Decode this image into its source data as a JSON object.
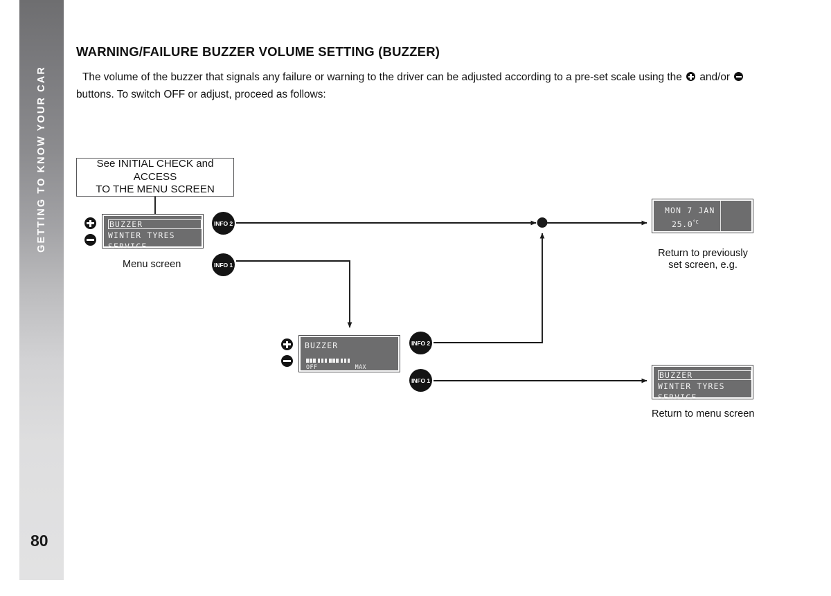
{
  "sidebar": {
    "chapter_label": "GETTING TO KNOW YOUR CAR",
    "page_number": "80"
  },
  "content": {
    "heading": "WARNING/FAILURE BUZZER VOLUME SETTING (BUZZER)",
    "paragraph_part_1": "The volume of the buzzer that signals any failure or warning to the driver can be adjusted according to a pre-set scale using the",
    "paragraph_part_2": "and/or",
    "paragraph_part_3": "buttons. To switch OFF or adjust, proceed as follows:"
  },
  "diagram": {
    "reference_box": {
      "line_1": "See INITIAL CHECK and ACCESS",
      "line_2": "TO THE MENU SCREEN"
    },
    "menu_display_top": {
      "line_1": "BUZZER",
      "line_2": "WINTER TYRES",
      "line_3": "SERVICE",
      "caption": "Menu screen"
    },
    "buzzer_display": {
      "title": "BUZZER",
      "scale_min_label": "OFF",
      "scale_max_label": "MAX",
      "volume_groups": 4,
      "segments_per_group": 3
    },
    "clock_display": {
      "date": "MON 7 JAN",
      "temperature": "25.0",
      "temperature_unit": "°C",
      "caption_line_1": "Return to previously",
      "caption_line_2": "set screen, e.g."
    },
    "menu_display_bottom": {
      "line_1": "BUZZER",
      "line_2": "WINTER TYRES",
      "line_3": "SERVICE",
      "caption": "Return to menu screen"
    },
    "info_buttons": {
      "top_info2": "INFO 2",
      "top_info1": "INFO 1",
      "mid_info2": "INFO 2",
      "mid_info1": "INFO 1"
    },
    "stepper_labels": {
      "increase": "plus",
      "decrease": "minus"
    }
  },
  "colors": {
    "lcd_background": "#6d6d6e",
    "lcd_text": "#f2f2f2",
    "ink": "#141414",
    "sidebar_top": "#6e6e70",
    "sidebar_bottom": "#e2e2e3"
  }
}
